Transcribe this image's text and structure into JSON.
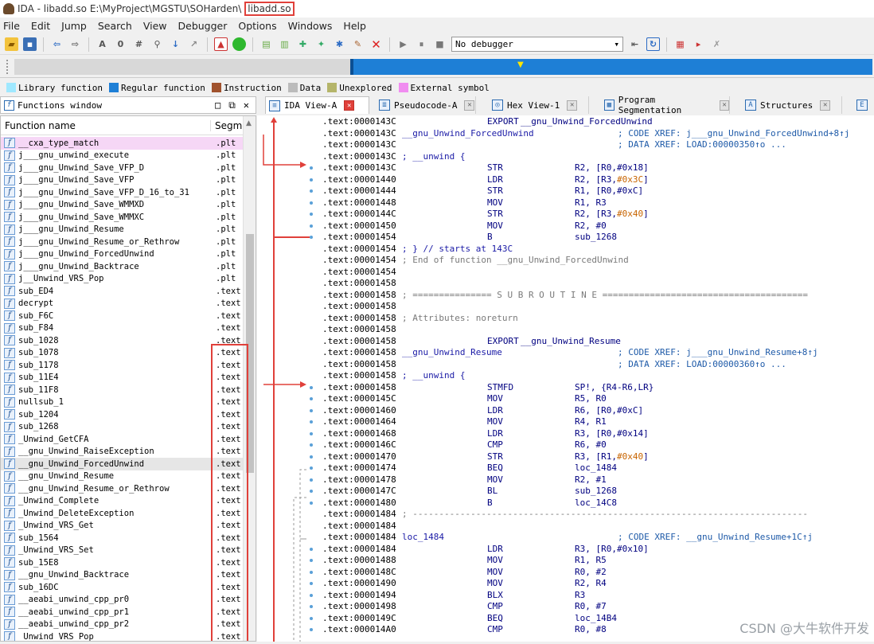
{
  "window": {
    "title": "IDA - libadd.so E:\\MyProject\\MGSTU\\SOHarden\\",
    "title_highlight": "libadd.so"
  },
  "menu": [
    "File",
    "Edit",
    "Jump",
    "Search",
    "View",
    "Debugger",
    "Options",
    "Windows",
    "Help"
  ],
  "toolbar": {
    "debugger_select": "No debugger"
  },
  "legend": [
    {
      "label": "Library function",
      "color": "#9fe8ff"
    },
    {
      "label": "Regular function",
      "color": "#1e7fd6"
    },
    {
      "label": "Instruction",
      "color": "#a0522d"
    },
    {
      "label": "Data",
      "color": "#bbbbbb"
    },
    {
      "label": "Unexplored",
      "color": "#b5b56a"
    },
    {
      "label": "External symbol",
      "color": "#f08cf0"
    }
  ],
  "functions_window": {
    "title": "Functions window",
    "col_name": "Function name",
    "col_segment": "Segme",
    "rows": [
      {
        "name": "__cxa_type_match",
        "seg": ".plt"
      },
      {
        "name": "j___gnu_unwind_execute",
        "seg": ".plt"
      },
      {
        "name": "j___gnu_Unwind_Save_VFP_D",
        "seg": ".plt"
      },
      {
        "name": "j___gnu_Unwind_Save_VFP",
        "seg": ".plt"
      },
      {
        "name": "j___gnu_Unwind_Save_VFP_D_16_to_31",
        "seg": ".plt"
      },
      {
        "name": "j___gnu_Unwind_Save_WMMXD",
        "seg": ".plt"
      },
      {
        "name": "j___gnu_Unwind_Save_WMMXC",
        "seg": ".plt"
      },
      {
        "name": "j___gnu_Unwind_Resume",
        "seg": ".plt"
      },
      {
        "name": "j___gnu_Unwind_Resume_or_Rethrow",
        "seg": ".plt"
      },
      {
        "name": "j___gnu_Unwind_ForcedUnwind",
        "seg": ".plt"
      },
      {
        "name": "j___gnu_Unwind_Backtrace",
        "seg": ".plt"
      },
      {
        "name": "j__Unwind_VRS_Pop",
        "seg": ".plt"
      },
      {
        "name": "sub_ED4",
        "seg": ".text"
      },
      {
        "name": "decrypt",
        "seg": ".text"
      },
      {
        "name": "sub_F6C",
        "seg": ".text"
      },
      {
        "name": "sub_F84",
        "seg": ".text"
      },
      {
        "name": "sub_1028",
        "seg": ".text"
      },
      {
        "name": "sub_1078",
        "seg": ".text"
      },
      {
        "name": "sub_1178",
        "seg": ".text"
      },
      {
        "name": "sub_11E4",
        "seg": ".text"
      },
      {
        "name": "sub_11F8",
        "seg": ".text"
      },
      {
        "name": "nullsub_1",
        "seg": ".text"
      },
      {
        "name": "sub_1204",
        "seg": ".text"
      },
      {
        "name": "sub_1268",
        "seg": ".text"
      },
      {
        "name": "_Unwind_GetCFA",
        "seg": ".text"
      },
      {
        "name": "__gnu_Unwind_RaiseException",
        "seg": ".text"
      },
      {
        "name": "__gnu_Unwind_ForcedUnwind",
        "seg": ".text"
      },
      {
        "name": "__gnu_Unwind_Resume",
        "seg": ".text"
      },
      {
        "name": "__gnu_Unwind_Resume_or_Rethrow",
        "seg": ".text"
      },
      {
        "name": "_Unwind_Complete",
        "seg": ".text"
      },
      {
        "name": "_Unwind_DeleteException",
        "seg": ".text"
      },
      {
        "name": "_Unwind_VRS_Get",
        "seg": ".text"
      },
      {
        "name": "sub_1564",
        "seg": ".text"
      },
      {
        "name": "_Unwind_VRS_Set",
        "seg": ".text"
      },
      {
        "name": "sub_15E8",
        "seg": ".text"
      },
      {
        "name": "__gnu_Unwind_Backtrace",
        "seg": ".text"
      },
      {
        "name": "sub_16DC",
        "seg": ".text"
      },
      {
        "name": "__aeabi_unwind_cpp_pr0",
        "seg": ".text"
      },
      {
        "name": "__aeabi_unwind_cpp_pr1",
        "seg": ".text"
      },
      {
        "name": "__aeabi_unwind_cpp_pr2",
        "seg": ".text"
      },
      {
        "name": "_Unwind_VRS_Pop",
        "seg": ".text"
      }
    ]
  },
  "tabs": [
    {
      "label": "IDA View-A",
      "icon": "listing-icon"
    },
    {
      "label": "Pseudocode-A",
      "icon": "pseudocode-icon"
    },
    {
      "label": "Hex View-1",
      "icon": "hex-icon"
    },
    {
      "label": "Program Segmentation",
      "icon": "segmentation-icon"
    },
    {
      "label": "Structures",
      "icon": "structures-icon"
    }
  ],
  "listing": [
    {
      "addr": ".text:0000143C",
      "label": "",
      "mnem": "EXPORT",
      "ops": "__gnu_Unwind_ForcedUnwind",
      "cmt": ""
    },
    {
      "addr": ".text:0000143C",
      "label": "__gnu_Unwind_ForcedUnwind",
      "mnem": "",
      "ops": "",
      "cmt": "; CODE XREF: j___gnu_Unwind_ForcedUnwind+8↑j"
    },
    {
      "addr": ".text:0000143C",
      "label": "",
      "mnem": "",
      "ops": "",
      "cmt": "; DATA XREF: LOAD:00000350↑o ..."
    },
    {
      "addr": ".text:0000143C",
      "label": "; __unwind {",
      "mnem": "",
      "ops": "",
      "cmt": ""
    },
    {
      "addr": ".text:0000143C",
      "label": "",
      "mnem": "STR",
      "ops": "R2, [R0,#0x18]",
      "cmt": ""
    },
    {
      "addr": ".text:00001440",
      "label": "",
      "mnem": "LDR",
      "ops": "R2, [R3,#0x3C]",
      "cmt": ""
    },
    {
      "addr": ".text:00001444",
      "label": "",
      "mnem": "STR",
      "ops": "R1, [R0,#0xC]",
      "cmt": ""
    },
    {
      "addr": ".text:00001448",
      "label": "",
      "mnem": "MOV",
      "ops": "R1, R3",
      "cmt": ""
    },
    {
      "addr": ".text:0000144C",
      "label": "",
      "mnem": "STR",
      "ops": "R2, [R3,#0x40]",
      "cmt": ""
    },
    {
      "addr": ".text:00001450",
      "label": "",
      "mnem": "MOV",
      "ops": "R2, #0",
      "cmt": ""
    },
    {
      "addr": ".text:00001454",
      "label": "",
      "mnem": "B",
      "ops": "sub_1268",
      "cmt": ""
    },
    {
      "addr": ".text:00001454",
      "label": "; } // starts at 143C",
      "mnem": "",
      "ops": "",
      "cmt": ""
    },
    {
      "addr": ".text:00001454",
      "label": "; End of function __gnu_Unwind_ForcedUnwind",
      "mnem": "",
      "ops": "",
      "cmt": ""
    },
    {
      "addr": ".text:00001454",
      "label": "",
      "mnem": "",
      "ops": "",
      "cmt": ""
    },
    {
      "addr": ".text:00001458",
      "label": "",
      "mnem": "",
      "ops": "",
      "cmt": ""
    },
    {
      "addr": ".text:00001458",
      "label": "; =============== S U B R O U T I N E =======================================",
      "mnem": "",
      "ops": "",
      "cmt": ""
    },
    {
      "addr": ".text:00001458",
      "label": "",
      "mnem": "",
      "ops": "",
      "cmt": ""
    },
    {
      "addr": ".text:00001458",
      "label": "; Attributes: noreturn",
      "mnem": "",
      "ops": "",
      "cmt": ""
    },
    {
      "addr": ".text:00001458",
      "label": "",
      "mnem": "",
      "ops": "",
      "cmt": ""
    },
    {
      "addr": ".text:00001458",
      "label": "",
      "mnem": "EXPORT",
      "ops": "__gnu_Unwind_Resume",
      "cmt": ""
    },
    {
      "addr": ".text:00001458",
      "label": "__gnu_Unwind_Resume",
      "mnem": "",
      "ops": "",
      "cmt": "; CODE XREF: j___gnu_Unwind_Resume+8↑j"
    },
    {
      "addr": ".text:00001458",
      "label": "",
      "mnem": "",
      "ops": "",
      "cmt": "; DATA XREF: LOAD:00000360↑o ..."
    },
    {
      "addr": ".text:00001458",
      "label": "; __unwind {",
      "mnem": "",
      "ops": "",
      "cmt": ""
    },
    {
      "addr": ".text:00001458",
      "label": "",
      "mnem": "STMFD",
      "ops": "SP!, {R4-R6,LR}",
      "cmt": ""
    },
    {
      "addr": ".text:0000145C",
      "label": "",
      "mnem": "MOV",
      "ops": "R5, R0",
      "cmt": ""
    },
    {
      "addr": ".text:00001460",
      "label": "",
      "mnem": "LDR",
      "ops": "R6, [R0,#0xC]",
      "cmt": ""
    },
    {
      "addr": ".text:00001464",
      "label": "",
      "mnem": "MOV",
      "ops": "R4, R1",
      "cmt": ""
    },
    {
      "addr": ".text:00001468",
      "label": "",
      "mnem": "LDR",
      "ops": "R3, [R0,#0x14]",
      "cmt": ""
    },
    {
      "addr": ".text:0000146C",
      "label": "",
      "mnem": "CMP",
      "ops": "R6, #0",
      "cmt": ""
    },
    {
      "addr": ".text:00001470",
      "label": "",
      "mnem": "STR",
      "ops": "R3, [R1,#0x40]",
      "cmt": ""
    },
    {
      "addr": ".text:00001474",
      "label": "",
      "mnem": "BEQ",
      "ops": "loc_1484",
      "cmt": ""
    },
    {
      "addr": ".text:00001478",
      "label": "",
      "mnem": "MOV",
      "ops": "R2, #1",
      "cmt": ""
    },
    {
      "addr": ".text:0000147C",
      "label": "",
      "mnem": "BL",
      "ops": "sub_1268",
      "cmt": ""
    },
    {
      "addr": ".text:00001480",
      "label": "",
      "mnem": "B",
      "ops": "loc_14C8",
      "cmt": ""
    },
    {
      "addr": ".text:00001484",
      "label": "; ---------------------------------------------------------------------------",
      "mnem": "",
      "ops": "",
      "cmt": ""
    },
    {
      "addr": ".text:00001484",
      "label": "",
      "mnem": "",
      "ops": "",
      "cmt": ""
    },
    {
      "addr": ".text:00001484",
      "label": "loc_1484",
      "mnem": "",
      "ops": "",
      "cmt": "; CODE XREF: __gnu_Unwind_Resume+1C↑j"
    },
    {
      "addr": ".text:00001484",
      "label": "",
      "mnem": "LDR",
      "ops": "R3, [R0,#0x10]",
      "cmt": ""
    },
    {
      "addr": ".text:00001488",
      "label": "",
      "mnem": "MOV",
      "ops": "R1, R5",
      "cmt": ""
    },
    {
      "addr": ".text:0000148C",
      "label": "",
      "mnem": "MOV",
      "ops": "R0, #2",
      "cmt": ""
    },
    {
      "addr": ".text:00001490",
      "label": "",
      "mnem": "MOV",
      "ops": "R2, R4",
      "cmt": ""
    },
    {
      "addr": ".text:00001494",
      "label": "",
      "mnem": "BLX",
      "ops": "R3",
      "cmt": ""
    },
    {
      "addr": ".text:00001498",
      "label": "",
      "mnem": "CMP",
      "ops": "R0, #7",
      "cmt": ""
    },
    {
      "addr": ".text:0000149C",
      "label": "",
      "mnem": "BEQ",
      "ops": "loc_14B4",
      "cmt": ""
    },
    {
      "addr": ".text:000014A0",
      "label": "",
      "mnem": "CMP",
      "ops": "R0, #8",
      "cmt": ""
    }
  ],
  "watermark": "CSDN @大牛软件开发"
}
